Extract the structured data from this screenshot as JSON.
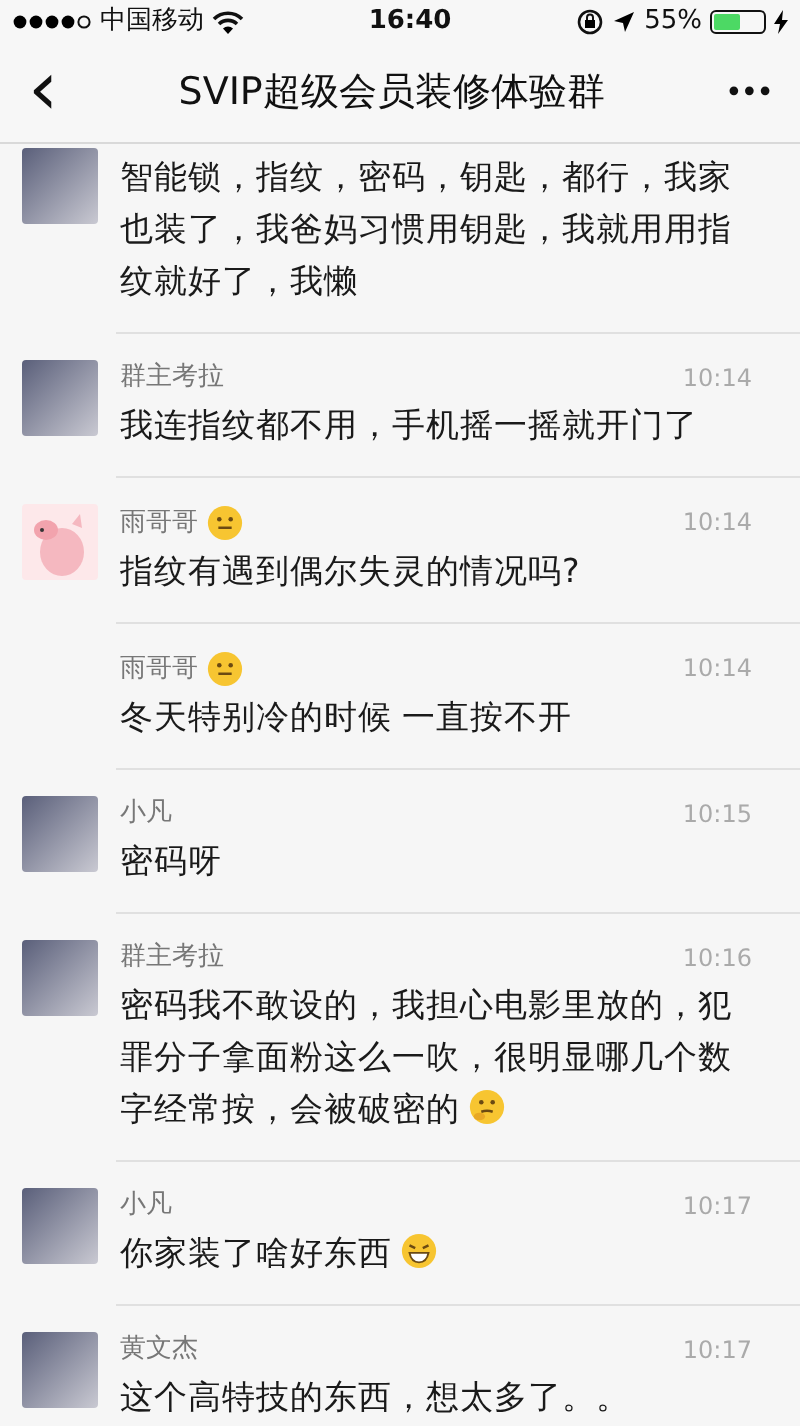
{
  "status_bar": {
    "carrier": "中国移动",
    "time": "16:40",
    "battery_text": "55%",
    "battery": {
      "level": 0.55
    }
  },
  "nav": {
    "back": "‹",
    "title": "SVIP超级会员装修体验群",
    "more": "•••"
  },
  "messages": [
    {
      "avatar": {
        "kind": "photo"
      },
      "text": "智能锁，指纹，密码，钥匙，都行，我家也装了，我爸妈习惯用钥匙，我就用用指纹就好了，我懒"
    },
    {
      "avatar": {
        "kind": "photo"
      },
      "name": "群主考拉",
      "time": "10:14",
      "text": "我连指纹都不用，手机摇一摇就开门了"
    },
    {
      "avatar": {
        "kind": "cartoon"
      },
      "name": "雨哥哥",
      "name_icon": {
        "kind": "smile"
      },
      "time": "10:14",
      "text": "指纹有遇到偶尔失灵的情况吗?"
    },
    {
      "name": "雨哥哥",
      "name_icon": {
        "kind": "smile"
      },
      "time": "10:14",
      "text": "冬天特别冷的时候 一直按不开"
    },
    {
      "avatar": {
        "kind": "photo"
      },
      "name": "小凡",
      "time": "10:15",
      "text": "密码呀"
    },
    {
      "avatar": {
        "kind": "photo"
      },
      "name": "群主考拉",
      "time": "10:16",
      "text": "密码我不敢设的，我担心电影里放的，犯罪分子拿面粉这么一吹，很明显哪几个数字经常按，会被破密的",
      "text_icon": {
        "kind": "thinking"
      }
    },
    {
      "avatar": {
        "kind": "photo"
      },
      "name": "小凡",
      "time": "10:17",
      "text": "你家装了啥好东西",
      "text_icon": {
        "kind": "grin"
      }
    },
    {
      "avatar": {
        "kind": "photo"
      },
      "name": "黄文杰",
      "time": "10:17",
      "text": "这个高特技的东西，想太多了。。"
    }
  ]
}
